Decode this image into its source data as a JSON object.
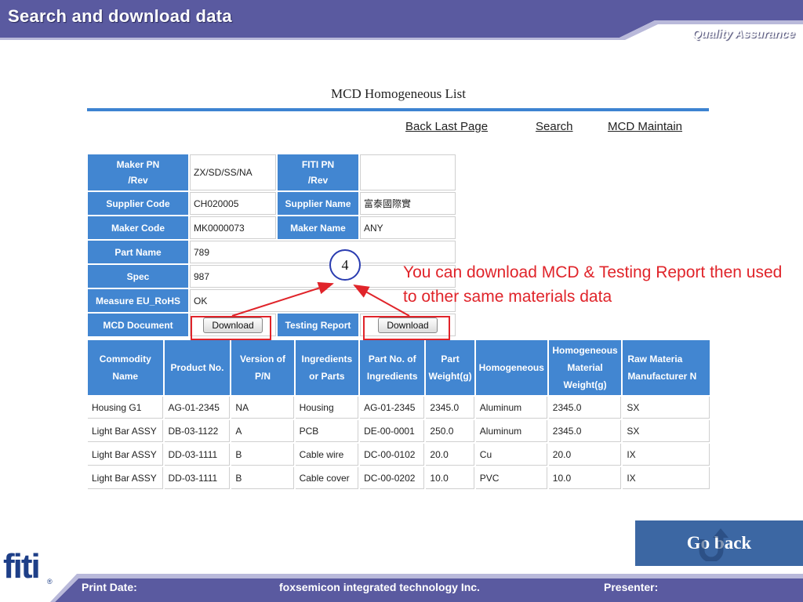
{
  "slide": {
    "title": "Search and download data",
    "subtitle": "Quality Assurance"
  },
  "page": {
    "title": "MCD Homogeneous List",
    "links": [
      "Back Last Page",
      "Search",
      "MCD Maintain"
    ]
  },
  "info": {
    "maker_pn_label": "Maker PN\n/Rev",
    "maker_pn_value": "ZX/SD/SS/NA",
    "fiti_pn_label": "FITI PN\n/Rev",
    "fiti_pn_value": "",
    "supplier_code_label": "Supplier Code",
    "supplier_code_value": "CH020005",
    "supplier_name_label": "Supplier Name",
    "supplier_name_value": "富泰國際實",
    "maker_code_label": "Maker Code",
    "maker_code_value": "MK0000073",
    "maker_name_label": "Maker Name",
    "maker_name_value": "ANY",
    "part_name_label": "Part Name",
    "part_name_value": "789",
    "spec_label": "Spec",
    "spec_value": "987",
    "measure_label": "Measure EU_RoHS",
    "measure_value": "OK",
    "mcd_doc_label": "MCD Document",
    "testing_report_label": "Testing Report",
    "download_label": "Download"
  },
  "table": {
    "headers": [
      "Commodity\nName",
      "Product No.",
      "Version of P/N",
      "Ingredients\nor Parts",
      "Part No. of\nIngredients",
      "Part\nWeight(g)",
      "Homogeneous",
      "Homogeneous\nMaterial\nWeight(g)",
      "Raw Materia\nManufacturer N"
    ],
    "rows": [
      [
        "Housing G1",
        "AG-01-2345",
        "NA",
        "Housing",
        "AG-01-2345",
        "2345.0",
        "Aluminum",
        "2345.0",
        "SX"
      ],
      [
        "Light Bar ASSY",
        "DB-03-1122",
        "A",
        "PCB",
        "DE-00-0001",
        "250.0",
        "Aluminum",
        "2345.0",
        "SX"
      ],
      [
        "Light Bar ASSY",
        "DD-03-1111",
        "B",
        "Cable wire",
        "DC-00-0102",
        "20.0",
        "Cu",
        "20.0",
        "IX"
      ],
      [
        "Light Bar ASSY",
        "DD-03-1111",
        "B",
        "Cable cover",
        "DC-00-0202",
        "10.0",
        "PVC",
        "10.0",
        "IX"
      ]
    ]
  },
  "callout": {
    "step": "4",
    "note": "You can download MCD & Testing Report then used to other same materials data"
  },
  "go_back": "Go back",
  "footer": {
    "print_date": "Print Date:",
    "company": "foxsemicon integrated technology Inc.",
    "presenter": "Presenter:",
    "logo": "fiti"
  },
  "colors": {
    "header_band": "#5a5aa0",
    "table_header": "#4286d1",
    "highlight": "#e0242a",
    "go_back_bg": "#3c67a3"
  }
}
